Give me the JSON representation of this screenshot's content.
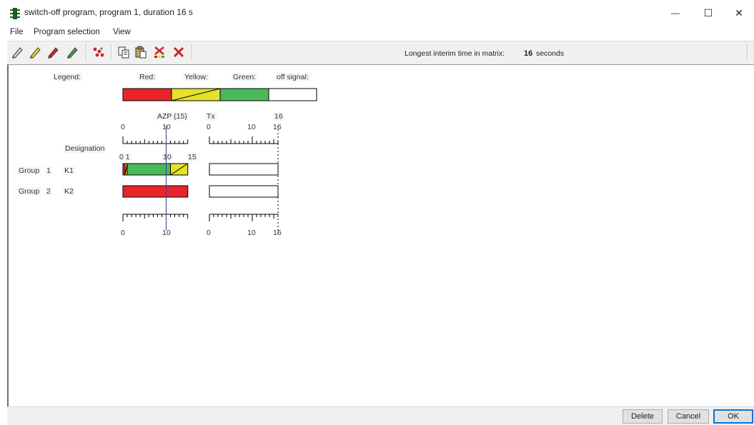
{
  "window": {
    "title": "switch-off program, program 1, duration 16 s",
    "minimize_glyph": "—",
    "maximize_glyph": "☐",
    "close_glyph": "✕"
  },
  "menu": [
    "File",
    "Program selection",
    "View"
  ],
  "toolbar": {
    "icons": [
      "pencil-gray-icon",
      "pencil-yellow-icon",
      "pencil-red-icon",
      "pencil-green-icon",
      "dots-icon",
      "copy-icon",
      "paste-icon",
      "clear-icon",
      "delete-x-icon"
    ],
    "interim_label": "Longest interim time in matrix:",
    "interim_value": "16",
    "interim_unit": "seconds"
  },
  "legend": {
    "title": "Legend:",
    "red": "Red:",
    "yellow": "Yellow:",
    "green": "Green:",
    "off": "off signal:"
  },
  "headers": {
    "azp": "AZP (15)",
    "tx": "Tx",
    "sixteen_top": "16",
    "designation": "Designation"
  },
  "scale_labels": {
    "left_top": [
      "0",
      "10"
    ],
    "right_top": [
      "0",
      "10",
      "16"
    ],
    "group1_marks": [
      "0 1",
      "10",
      "15"
    ],
    "left_bottom": [
      "0",
      "10"
    ],
    "right_bottom": [
      "0",
      "10",
      "16"
    ]
  },
  "groups": [
    {
      "label": "Group",
      "number": "1",
      "designation": "K1"
    },
    {
      "label": "Group",
      "number": "2",
      "designation": "K2"
    }
  ],
  "signal_timing": {
    "duration_s": 16,
    "azp_s": 15,
    "group1": [
      {
        "color": "red",
        "start": 0,
        "end": 0.5
      },
      {
        "color": "red-yellow",
        "start": 0.5,
        "end": 1
      },
      {
        "color": "green",
        "start": 1,
        "end": 11
      },
      {
        "color": "yellow",
        "start": 11,
        "end": 15
      }
    ],
    "group2": [
      {
        "color": "red",
        "start": 0,
        "end": 15
      }
    ],
    "cursor_s": 10
  },
  "colors": {
    "red": "#e8262a",
    "yellow": "#e6e12a",
    "green": "#4cb85c",
    "off": "#ffffff",
    "cursor": "#3a3aa0"
  },
  "buttons": {
    "delete": "Delete",
    "cancel": "Cancel",
    "ok": "OK"
  }
}
